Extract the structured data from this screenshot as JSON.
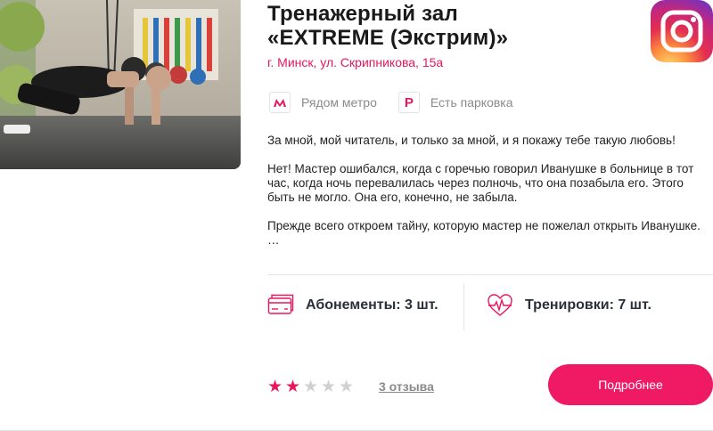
{
  "club": {
    "title_line1": "Тренажерный зал",
    "title_line2": "«EXTREME (Экстрим)»",
    "address": "г. Минск, ул. Скрипникова, 15а"
  },
  "features": [
    {
      "label": "Рядом метро",
      "icon": "metro-icon"
    },
    {
      "label": "Есть парковка",
      "icon": "parking-icon",
      "glyph": "P"
    }
  ],
  "description": {
    "p1": "За мной, мой читатель, и только за мной, и я покажу тебе такую любовь!",
    "p2": "Нет! Мастер ошибался, когда с горечью говорил Иванушке в больнице в тот час, когда ночь перевалилась через полночь, что она позабыла его. Этого быть не могло. Она его, конечно, не забыла.",
    "p3": "Прежде всего откроем тайну, которую мастер не пожелал открыть Иванушке.",
    "ellipsis": "…"
  },
  "stats": {
    "subscriptions": "Абонементы: 3 шт.",
    "trainings": "Тренировки: 7 шт."
  },
  "rating": {
    "value": 2,
    "max": 5,
    "star_char": "★"
  },
  "reviews_link": "3 отзыва",
  "details_button": "Подробнее",
  "colors": {
    "accent": "#e8175d",
    "muted": "#8a8a8a"
  }
}
